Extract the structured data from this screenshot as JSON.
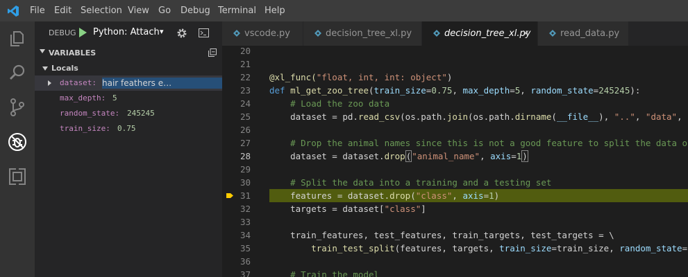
{
  "menu": [
    "File",
    "Edit",
    "Selection",
    "View",
    "Go",
    "Debug",
    "Terminal",
    "Help"
  ],
  "debug": {
    "label": "DEBUG",
    "config": "Python: Attach",
    "caret": "▾"
  },
  "variables": {
    "section": "VARIABLES",
    "scope": "Locals",
    "items": [
      {
        "name": "dataset:",
        "value": "",
        "preview": "   hair   feathers   e…"
      },
      {
        "name": "max_depth:",
        "value": "5"
      },
      {
        "name": "random_state:",
        "value": "245245"
      },
      {
        "name": "train_size:",
        "value": "0.75"
      }
    ]
  },
  "tabs": [
    {
      "label": "vscode.py"
    },
    {
      "label": "decision_tree_xl.py"
    },
    {
      "label": "decision_tree_xl.py",
      "close": "×"
    },
    {
      "label": "read_data.py"
    }
  ],
  "colors": {
    "accent": "#007acc",
    "highlight": "#4b4b18"
  },
  "lines": [
    {
      "n": "20",
      "segs": []
    },
    {
      "n": "21",
      "segs": []
    },
    {
      "n": "22",
      "segs": [
        {
          "t": "@xl_func(",
          "c": "c-fn"
        },
        {
          "t": "\"float, int, int: object\"",
          "c": "c-str"
        },
        {
          "t": ")",
          "c": ""
        }
      ]
    },
    {
      "n": "23",
      "segs": [
        {
          "t": "def ",
          "c": "c-kw"
        },
        {
          "t": "ml_get_zoo_tree",
          "c": "c-fn"
        },
        {
          "t": "(",
          "c": ""
        },
        {
          "t": "train_size",
          "c": "c-p"
        },
        {
          "t": "=",
          "c": ""
        },
        {
          "t": "0.75",
          "c": "c-num"
        },
        {
          "t": ", ",
          "c": ""
        },
        {
          "t": "max_depth",
          "c": "c-p"
        },
        {
          "t": "=",
          "c": ""
        },
        {
          "t": "5",
          "c": "c-num"
        },
        {
          "t": ", ",
          "c": ""
        },
        {
          "t": "random_state",
          "c": "c-p"
        },
        {
          "t": "=",
          "c": ""
        },
        {
          "t": "245245",
          "c": "c-num"
        },
        {
          "t": "):",
          "c": ""
        }
      ]
    },
    {
      "n": "24",
      "segs": [
        {
          "t": "    # Load the zoo data",
          "c": "c-cm"
        }
      ]
    },
    {
      "n": "25",
      "segs": [
        {
          "t": "    dataset = pd.",
          "c": ""
        },
        {
          "t": "read_csv",
          "c": "c-fn"
        },
        {
          "t": "(os.path.",
          "c": ""
        },
        {
          "t": "join",
          "c": "c-fn"
        },
        {
          "t": "(os.path.",
          "c": ""
        },
        {
          "t": "dirname",
          "c": "c-fn"
        },
        {
          "t": "(",
          "c": ""
        },
        {
          "t": "__file__",
          "c": "c-p"
        },
        {
          "t": "), ",
          "c": ""
        },
        {
          "t": "\"..\"",
          "c": "c-str"
        },
        {
          "t": ", ",
          "c": ""
        },
        {
          "t": "\"data\"",
          "c": "c-str"
        },
        {
          "t": ",",
          "c": ""
        }
      ]
    },
    {
      "n": "26",
      "segs": []
    },
    {
      "n": "27",
      "segs": [
        {
          "t": "    # Drop the animal names since this is not a good feature to split the data on",
          "c": "c-cm"
        }
      ]
    },
    {
      "n": "28",
      "cur": true,
      "segs": [
        {
          "t": "    dataset = dataset.",
          "c": ""
        },
        {
          "t": "drop",
          "c": "c-fn"
        },
        {
          "t": "(",
          "c": "box"
        },
        {
          "t": "\"animal_name\"",
          "c": "c-str"
        },
        {
          "t": ", ",
          "c": ""
        },
        {
          "t": "axis",
          "c": "c-p"
        },
        {
          "t": "=",
          "c": ""
        },
        {
          "t": "1",
          "c": "c-num"
        },
        {
          "t": ")",
          "c": "box"
        }
      ]
    },
    {
      "n": "29",
      "segs": []
    },
    {
      "n": "30",
      "segs": [
        {
          "t": "    # Split the data into a training and a testing set",
          "c": "c-cm"
        }
      ]
    },
    {
      "n": "31",
      "hl": true,
      "segs": [
        {
          "t": "    features = dataset.",
          "c": ""
        },
        {
          "t": "drop",
          "c": "c-fn"
        },
        {
          "t": "(",
          "c": ""
        },
        {
          "t": "\"class\"",
          "c": "c-str"
        },
        {
          "t": ", ",
          "c": ""
        },
        {
          "t": "axis",
          "c": "c-p"
        },
        {
          "t": "=",
          "c": ""
        },
        {
          "t": "1",
          "c": "c-num"
        },
        {
          "t": ")",
          "c": ""
        }
      ]
    },
    {
      "n": "32",
      "segs": [
        {
          "t": "    targets = dataset[",
          "c": ""
        },
        {
          "t": "\"class\"",
          "c": "c-str"
        },
        {
          "t": "]",
          "c": ""
        }
      ]
    },
    {
      "n": "33",
      "segs": []
    },
    {
      "n": "34",
      "segs": [
        {
          "t": "    train_features, test_features, train_targets, test_targets = \\",
          "c": ""
        }
      ]
    },
    {
      "n": "35",
      "segs": [
        {
          "t": "        ",
          "c": ""
        },
        {
          "t": "train_test_split",
          "c": "c-fn"
        },
        {
          "t": "(features, targets, ",
          "c": ""
        },
        {
          "t": "train_size",
          "c": "c-p"
        },
        {
          "t": "=train_size, ",
          "c": ""
        },
        {
          "t": "random_state",
          "c": "c-p"
        },
        {
          "t": "=random_state)",
          "c": ""
        }
      ]
    },
    {
      "n": "36",
      "segs": []
    },
    {
      "n": "37",
      "segs": [
        {
          "t": "    # Train the model",
          "c": "c-cm"
        }
      ]
    }
  ]
}
